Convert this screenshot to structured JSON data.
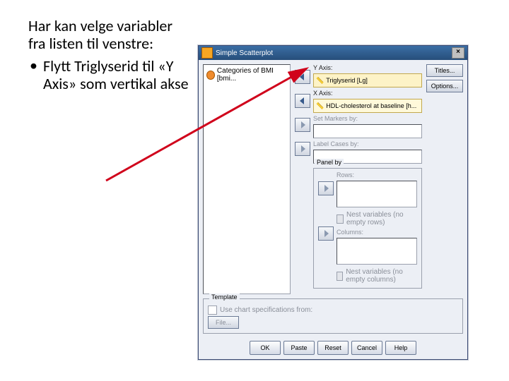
{
  "instruction": {
    "line1": "Har kan velge variabler fra listen til venstre:",
    "bullet1": "Flytt Triglyserid til «Y Axis» som vertikal akse"
  },
  "dialog": {
    "title": "Simple Scatterplot",
    "variables": [
      {
        "label": "Categories of BMI [bmi...",
        "kind": "nominal"
      }
    ],
    "y_axis": {
      "label": "Y Axis:",
      "value": "Triglyserid [Lg]"
    },
    "x_axis": {
      "label": "X Axis:",
      "value": "HDL-cholesterol at baseline [h..."
    },
    "set_markers": {
      "label": "Set Markers by:",
      "value": ""
    },
    "label_cases": {
      "label": "Label Cases by:",
      "value": ""
    },
    "panel": {
      "title": "Panel by",
      "rows_label": "Rows:",
      "rows_value": "",
      "rows_nest": "Nest variables (no empty rows)",
      "cols_label": "Columns:",
      "cols_value": "",
      "cols_nest": "Nest variables (no empty columns)"
    },
    "template": {
      "title": "Template",
      "use_spec": "Use chart specifications from:",
      "file": "File..."
    },
    "side": {
      "titles": "Titles...",
      "options": "Options..."
    },
    "buttons": {
      "ok": "OK",
      "paste": "Paste",
      "reset": "Reset",
      "cancel": "Cancel",
      "help": "Help"
    }
  }
}
